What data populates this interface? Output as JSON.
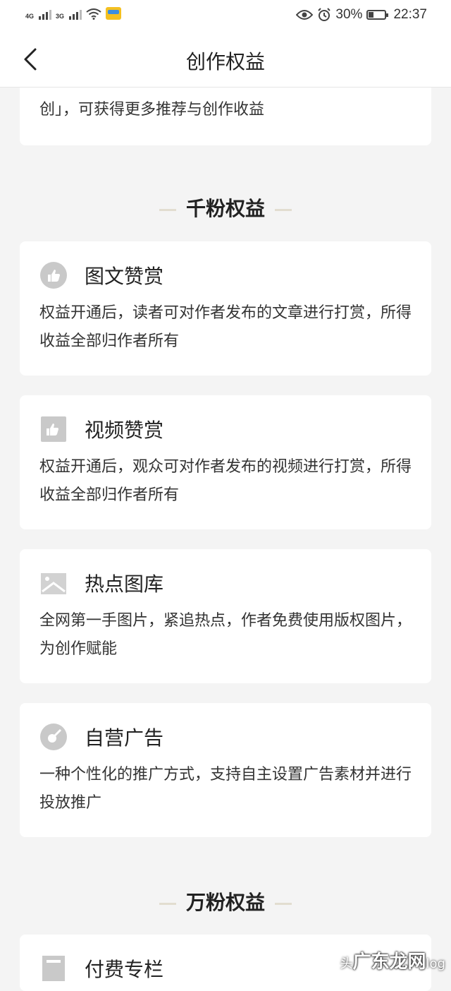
{
  "status_bar": {
    "network1": "4G",
    "network2": "3G",
    "battery_text": "30%",
    "battery_level": 0.3,
    "time": "22:37"
  },
  "header": {
    "title": "创作权益"
  },
  "top_card": {
    "tail_text": "创」，可获得更多推荐与创作收益"
  },
  "sections": {
    "qianfen": "千粉权益",
    "wanfen": "万粉权益"
  },
  "cards": [
    {
      "icon": "thumbs-up-circle-icon",
      "title": "图文赞赏",
      "desc": "权益开通后，读者可对作者发布的文章进行打赏，所得收益全部归作者所有"
    },
    {
      "icon": "thumbs-up-square-icon",
      "title": "视频赞赏",
      "desc": "权益开通后，观众可对作者发布的视频进行打赏，所得收益全部归作者所有"
    },
    {
      "icon": "image-gallery-icon",
      "title": "热点图库",
      "desc": "全网第一手图片，紧追热点，作者免费使用版权图片，为创作赋能"
    },
    {
      "icon": "ad-circle-icon",
      "title": "自营广告",
      "desc": "一种个性化的推广方式，支持自主设置广告素材并进行投放推广"
    },
    {
      "icon": "column-icon",
      "title": "付费专栏",
      "desc": ""
    }
  ],
  "watermark": {
    "small": "头",
    "main": "广东龙网",
    "suffix": "log"
  }
}
